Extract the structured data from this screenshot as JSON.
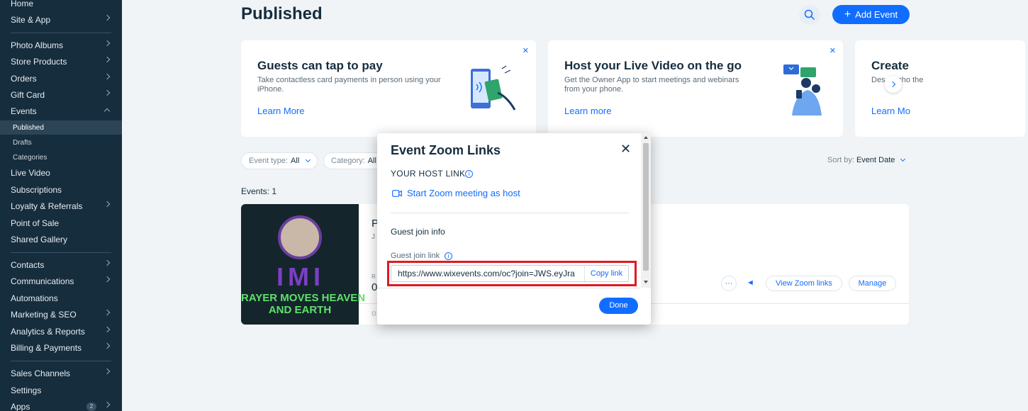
{
  "sidebar": {
    "items": [
      {
        "label": "Home"
      },
      {
        "label": "Site & App"
      },
      {
        "label": "Photo Albums"
      },
      {
        "label": "Store Products"
      },
      {
        "label": "Orders"
      },
      {
        "label": "Gift Card"
      },
      {
        "label": "Events"
      },
      {
        "label": "Published"
      },
      {
        "label": "Drafts"
      },
      {
        "label": "Categories"
      },
      {
        "label": "Live Video"
      },
      {
        "label": "Subscriptions"
      },
      {
        "label": "Loyalty & Referrals"
      },
      {
        "label": "Point of Sale"
      },
      {
        "label": "Shared Gallery"
      },
      {
        "label": "Contacts"
      },
      {
        "label": "Communications"
      },
      {
        "label": "Automations"
      },
      {
        "label": "Marketing & SEO"
      },
      {
        "label": "Analytics & Reports"
      },
      {
        "label": "Billing & Payments"
      },
      {
        "label": "Sales Channels"
      },
      {
        "label": "Settings"
      },
      {
        "label": "Apps",
        "badge": "2"
      }
    ]
  },
  "header": {
    "title": "Published",
    "add_label": "Add Event"
  },
  "promos": [
    {
      "title": "Guests can tap to pay",
      "desc": "Take contactless card payments in person using your iPhone.",
      "link": "Learn More"
    },
    {
      "title": "Host your Live Video on the go",
      "desc": "Get the Owner App to start meetings and webinars from your phone.",
      "link": "Learn more"
    },
    {
      "title": "Create",
      "desc": "Des  n i  cho  the",
      "link": "Learn Mo"
    }
  ],
  "filters": {
    "event_type_label": "Event type:",
    "event_type_value": "All",
    "category_label": "Category:",
    "category_value": "All",
    "sort_label": "Sort by:",
    "sort_value": "Event Date"
  },
  "events_count": "Events: 1",
  "event": {
    "image_line1": "RAYER MOVES HEAVEN",
    "image_line2": "AND EARTH",
    "image_letters": "IMI",
    "title_initial": "P",
    "date_initial": "J",
    "rsvp_initial": "R",
    "rsvp_value": "0",
    "view_zoom_label": "View Zoom links",
    "manage_label": "Manage"
  },
  "modal": {
    "title": "Event Zoom Links",
    "host_link_label": "YOUR HOST LINK",
    "start_zoom_label": "Start Zoom meeting as host",
    "guest_info_label": "Guest join info",
    "guest_link_label": "Guest join link",
    "guest_link_value": "https://www.wixevents.com/oc?join=JWS.eyJra",
    "copy_label": "Copy link",
    "done_label": "Done"
  }
}
